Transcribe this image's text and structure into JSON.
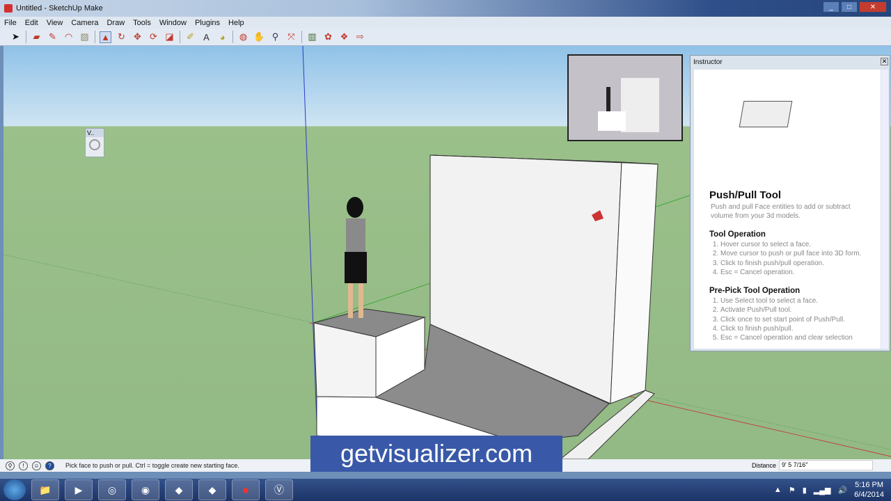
{
  "window": {
    "title": "Untitled - SketchUp Make"
  },
  "menu": [
    "File",
    "Edit",
    "View",
    "Camera",
    "Draw",
    "Tools",
    "Window",
    "Plugins",
    "Help"
  ],
  "toolbar": [
    "select",
    "eraser",
    "pencil",
    "arc",
    "rectangle",
    "push-pull",
    "follow-me",
    "move",
    "rotate",
    "scale",
    "tape-measure",
    "text",
    "paint-bucket",
    "orbit",
    "pan",
    "zoom",
    "zoom-extents",
    "components",
    "warehouse",
    "extension",
    "send-to-layout"
  ],
  "mini_toolbar": {
    "label": "V.."
  },
  "instructor": {
    "title": "Instructor",
    "tool_title": "Push/Pull Tool",
    "description": "Push and pull Face entities to add or subtract volume from your 3d models.",
    "sections": [
      {
        "heading": "Tool Operation",
        "steps": [
          "Hover cursor to select a face.",
          "Move cursor to push or pull face into 3D form.",
          "Click to finish push/pull operation.",
          "Esc = Cancel operation."
        ]
      },
      {
        "heading": "Pre-Pick Tool Operation",
        "steps": [
          "Use Select tool to select a face.",
          "Activate Push/Pull tool.",
          "Click once to set start point of Push/Pull.",
          "Click to finish push/pull.",
          "Esc = Cancel operation and clear selection"
        ]
      }
    ]
  },
  "status": {
    "text": "Pick face to push or pull.  Ctrl = toggle create new starting face.",
    "distance_label": "Distance",
    "distance_value": "9' 5 7/16\""
  },
  "watermark": "getvisualizer.com",
  "taskbar": {
    "apps": [
      "explorer",
      "media-player",
      "network",
      "chrome",
      "app-1",
      "app-2",
      "sketchup",
      "visualizer"
    ],
    "time": "5:16 PM",
    "date": "6/4/2014"
  }
}
